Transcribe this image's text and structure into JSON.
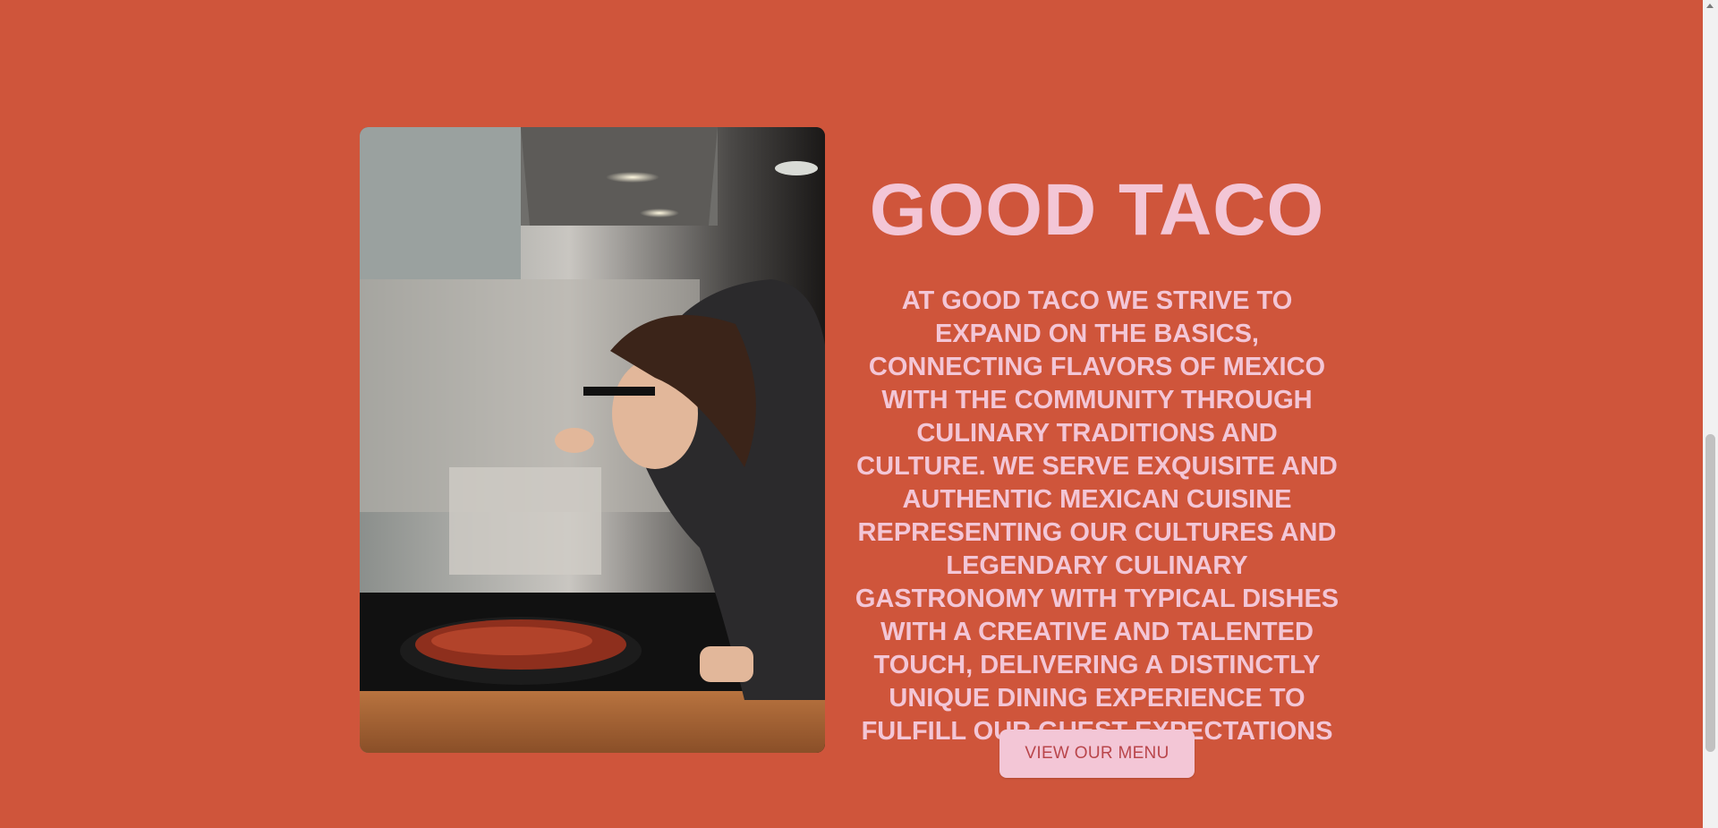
{
  "hero": {
    "title": "GOOD TACO",
    "description": "AT GOOD TACO WE STRIVE TO EXPAND ON THE BASICS, CONNECTING FLAVORS OF MEXICO WITH THE COMMUNITY THROUGH CULINARY TRADITIONS AND CULTURE. WE SERVE EXQUISITE AND AUTHENTIC MEXICAN CUISINE REPRESENTING OUR CULTURES AND LEGENDARY CULINARY GASTRONOMY WITH TYPICAL DISHES WITH A CREATIVE AND TALENTED TOUCH, DELIVERING A DISTINCTLY UNIQUE DINING EXPERIENCE TO FULFILL OUR GUEST EXPECTATIONS",
    "menu_button_label": "VIEW OUR MENU"
  },
  "photo": {
    "icon": "chef-tasting-food-photo"
  },
  "colors": {
    "background": "#cf553b",
    "accent_text": "#f3c6d6",
    "button_text": "#b9464b"
  }
}
